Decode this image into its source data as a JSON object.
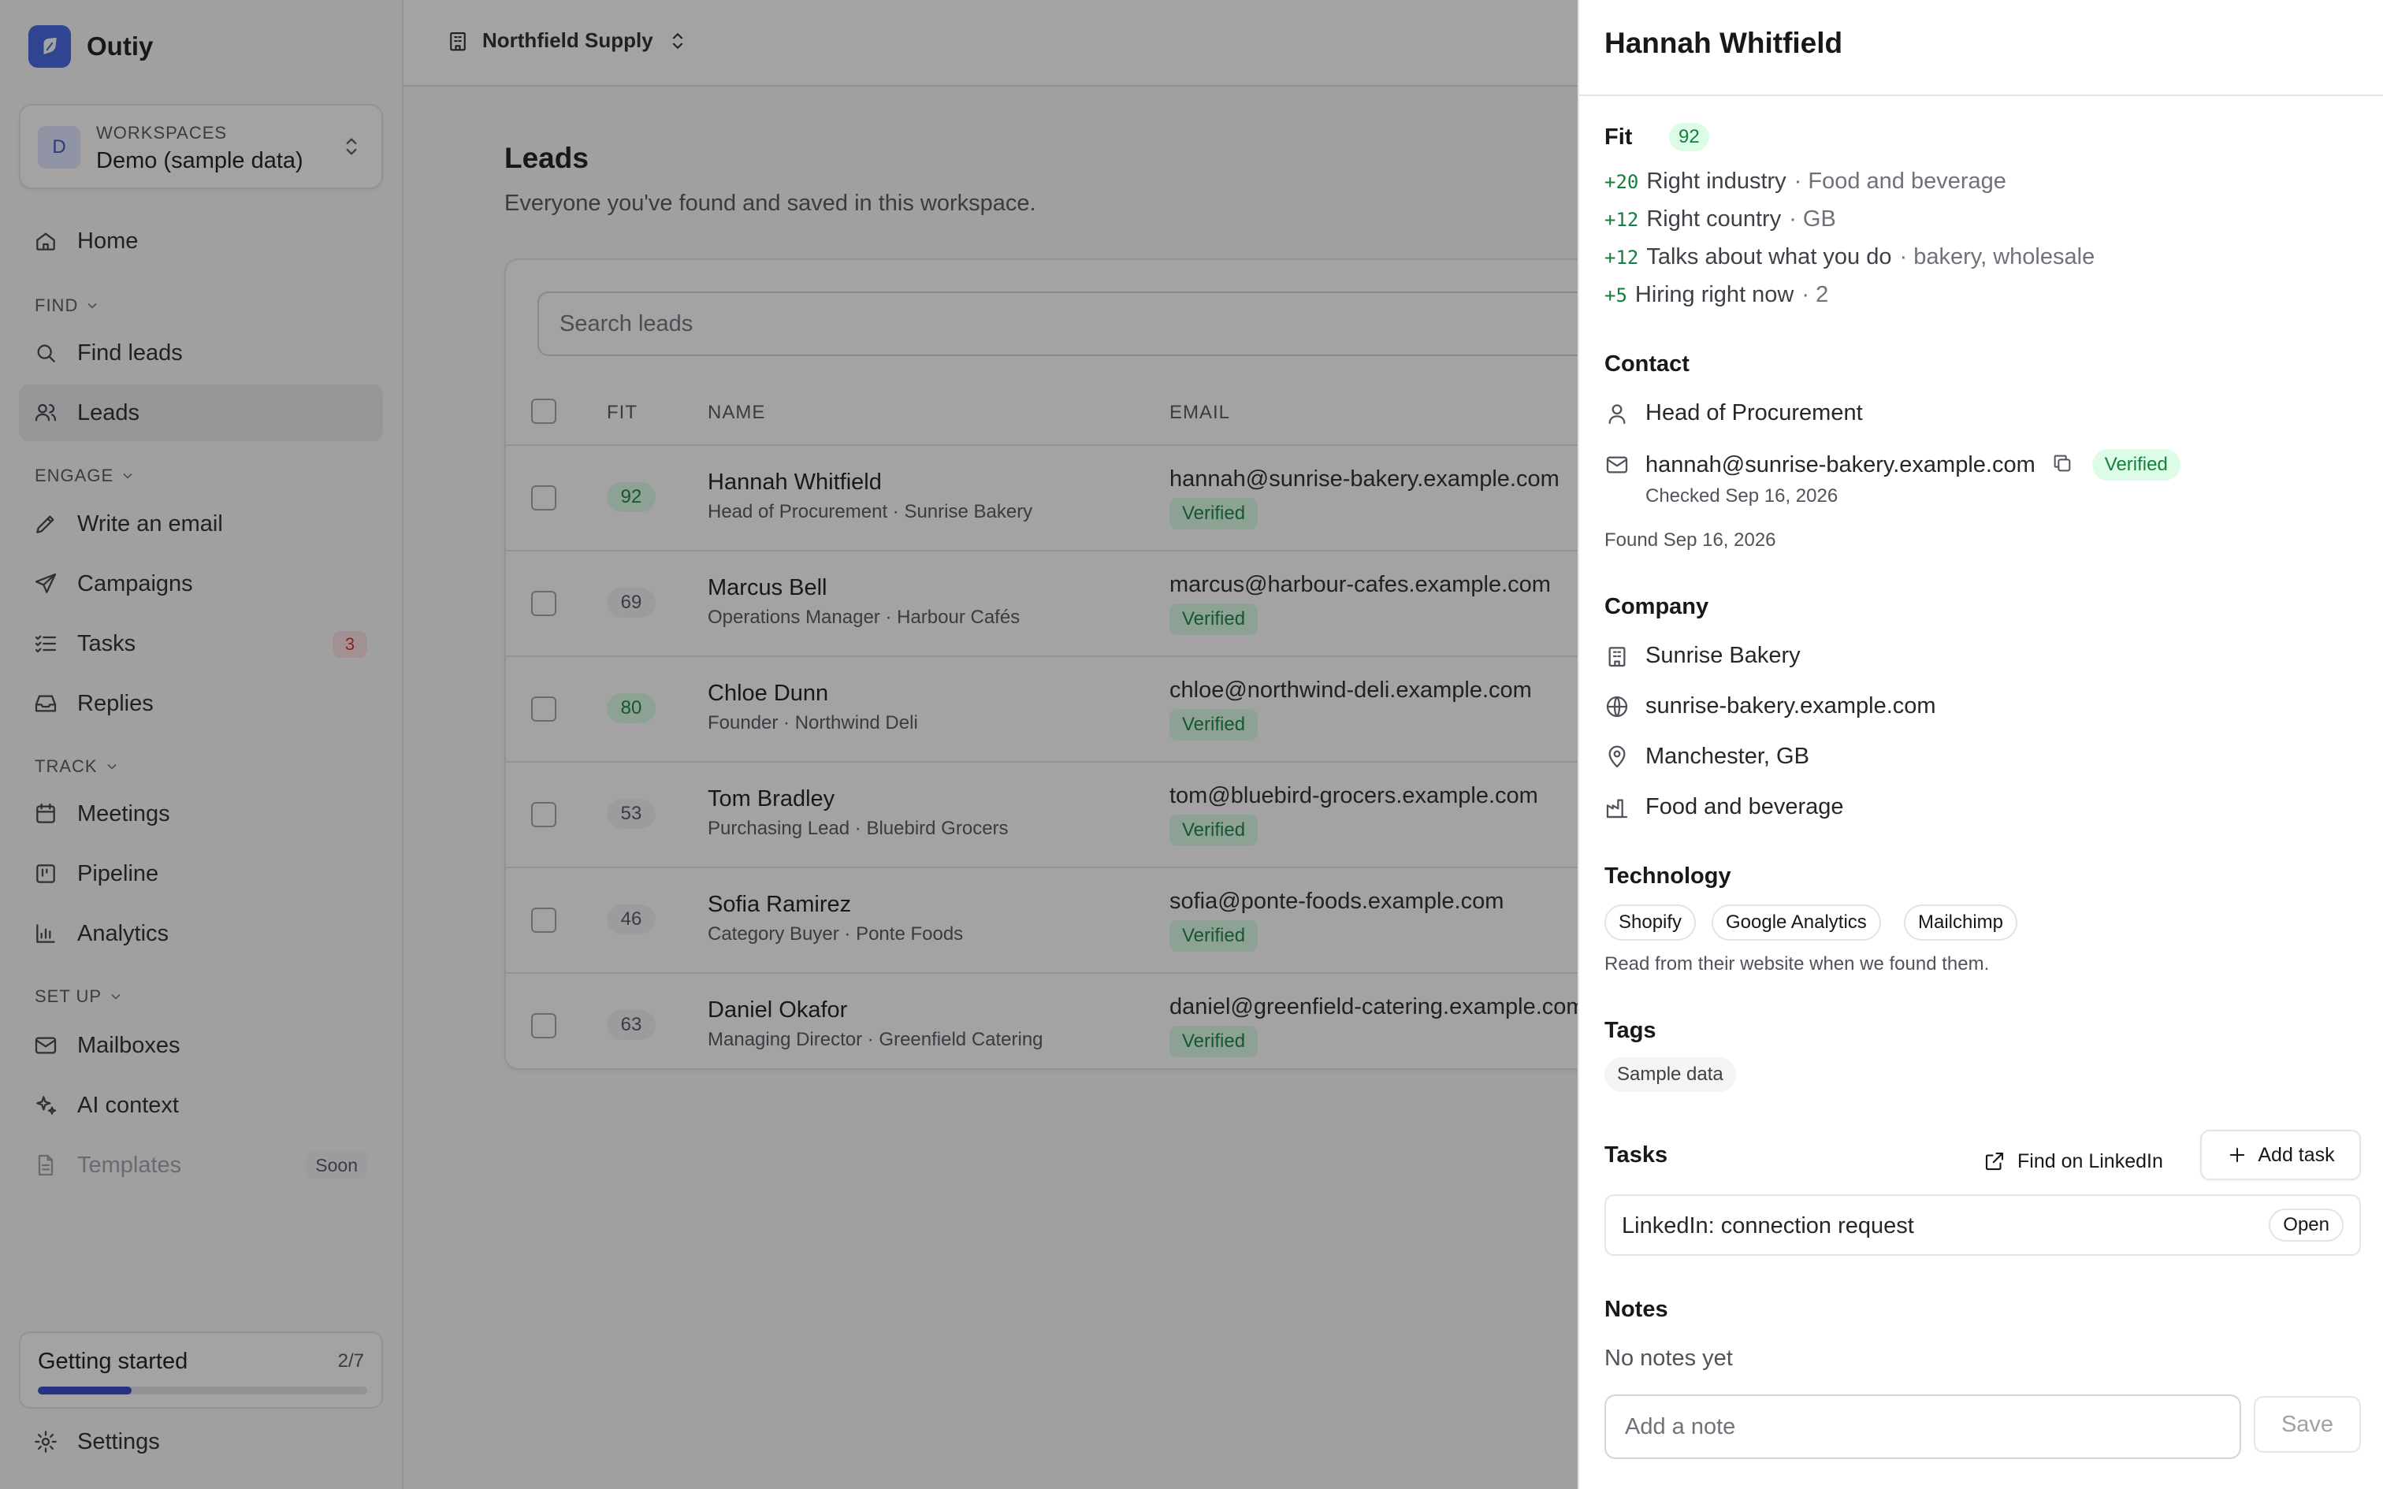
{
  "app": {
    "name": "Outiy"
  },
  "workspace": {
    "label": "WORKSPACES",
    "name": "Demo (sample data)",
    "avatar": "D"
  },
  "nav": {
    "home": "Home",
    "find_section": "FIND",
    "find_leads": "Find leads",
    "leads": "Leads",
    "engage_section": "ENGAGE",
    "write_email": "Write an email",
    "campaigns": "Campaigns",
    "tasks": "Tasks",
    "tasks_badge": "3",
    "replies": "Replies",
    "track_section": "TRACK",
    "meetings": "Meetings",
    "pipeline": "Pipeline",
    "analytics": "Analytics",
    "setup_section": "SET UP",
    "mailboxes": "Mailboxes",
    "ai_context": "AI context",
    "templates": "Templates",
    "templates_badge": "Soon",
    "settings": "Settings"
  },
  "getting_started": {
    "label": "Getting started",
    "count": "2/7",
    "progress": 0.2857
  },
  "topbar": {
    "org_name": "Northfield Supply"
  },
  "page": {
    "title": "Leads",
    "subtitle": "Everyone you've found and saved in this workspace."
  },
  "search": {
    "placeholder": "Search leads"
  },
  "table": {
    "columns": {
      "fit": "FIT",
      "name": "NAME",
      "email": "EMAIL"
    },
    "rows": [
      {
        "fit": "92",
        "name": "Hannah Whitfield",
        "sub": "Head of Procurement · Sunrise Bakery",
        "email": "hannah@sunrise-bakery.example.com",
        "status": "Verified"
      },
      {
        "fit": "69",
        "name": "Marcus Bell",
        "sub": "Operations Manager · Harbour Cafés",
        "email": "marcus@harbour-cafes.example.com",
        "status": "Verified"
      },
      {
        "fit": "80",
        "name": "Chloe Dunn",
        "sub": "Founder · Northwind Deli",
        "email": "chloe@northwind-deli.example.com",
        "status": "Verified"
      },
      {
        "fit": "53",
        "name": "Tom Bradley",
        "sub": "Purchasing Lead · Bluebird Grocers",
        "email": "tom@bluebird-grocers.example.com",
        "status": "Verified"
      },
      {
        "fit": "46",
        "name": "Sofia Ramirez",
        "sub": "Category Buyer · Ponte Foods",
        "email": "sofia@ponte-foods.example.com",
        "status": "Verified"
      },
      {
        "fit": "63",
        "name": "Daniel Okafor",
        "sub": "Managing Director · Greenfield Catering",
        "email": "daniel@greenfield-catering.example.com",
        "status": "Verified"
      }
    ]
  },
  "drawer": {
    "name": "Hannah Whitfield",
    "fit": {
      "label": "Fit",
      "score": "92",
      "reasons": [
        {
          "points": "+20",
          "label": "Right industry",
          "detail": "· Food and beverage"
        },
        {
          "points": "+12",
          "label": "Right country",
          "detail": "· GB"
        },
        {
          "points": "+12",
          "label": "Talks about what you do",
          "detail": "· bakery, wholesale"
        },
        {
          "points": "+5",
          "label": "Hiring right now",
          "detail": "· 2"
        }
      ]
    },
    "contact": {
      "label": "Contact",
      "title": "Head of Procurement",
      "email": "hannah@sunrise-bakery.example.com",
      "email_status": "Verified",
      "checked": "Checked Sep 16, 2026",
      "found": "Found Sep 16, 2026"
    },
    "company": {
      "label": "Company",
      "name": "Sunrise Bakery",
      "website": "sunrise-bakery.example.com",
      "location": "Manchester, GB",
      "industry": "Food and beverage"
    },
    "technology": {
      "label": "Technology",
      "items": [
        "Shopify",
        "Google Analytics",
        "Mailchimp"
      ],
      "note": "Read from their website when we found them."
    },
    "tags": {
      "label": "Tags",
      "items": [
        "Sample data"
      ]
    },
    "tasks": {
      "label": "Tasks",
      "linkedin_button": "Find on LinkedIn",
      "add_button": "Add task",
      "items": [
        {
          "label": "LinkedIn: connection request",
          "status": "Open"
        }
      ]
    },
    "notes": {
      "label": "Notes",
      "empty": "No notes yet",
      "placeholder": "Add a note",
      "save": "Save"
    }
  },
  "colors": {
    "accent": "#3f63e0",
    "success_bg": "#dcfce7",
    "success_text": "#15803d",
    "danger": "#dc2626"
  }
}
